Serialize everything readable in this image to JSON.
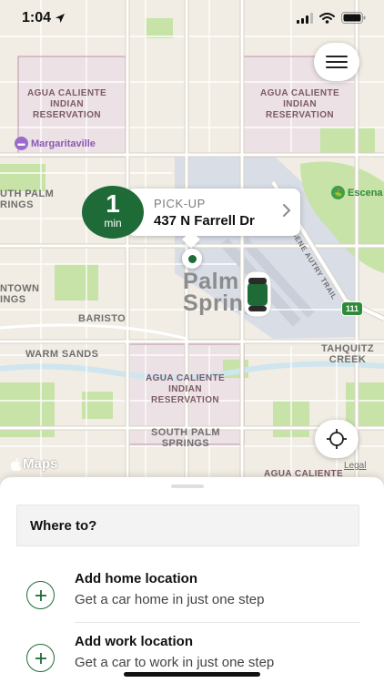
{
  "status_bar": {
    "time": "1:04"
  },
  "map": {
    "labels": {
      "res_nw": "AGUA CALIENTE\nINDIAN\nRESERVATION",
      "res_ne": "AGUA CALIENTE\nINDIAN\nRESERVATION",
      "res_center": "AGUA CALIENTE\nINDIAN\nRESERVATION",
      "res_bottom": "AGUA CALIENTE",
      "south_palm_left": "UTH PALM\nRINGS",
      "downtown": "NTOWN\nINGS",
      "baristo": "BARISTO",
      "warm_sands": "WARM SANDS",
      "tahquitz": "TAHQUITZ\nCREEK",
      "south_palm_bottom": "SOUTH PALM\nSPRINGS",
      "city": "Palm\nSprings",
      "road": "GENE AUTRY TRAIL",
      "highway": "111"
    },
    "poi": {
      "margaritaville": "Margaritaville",
      "escena": "Escena"
    },
    "brand": "Maps",
    "legal": "Legal"
  },
  "pickup": {
    "eta_value": "1",
    "eta_unit": "min",
    "label": "PICK-UP",
    "address": "437 N Farrell Dr"
  },
  "sheet": {
    "search_label": "Where to?",
    "items": [
      {
        "title": "Add home location",
        "subtitle": "Get a car home in just one step"
      },
      {
        "title": "Add work location",
        "subtitle": "Get a car to work in just one step"
      }
    ]
  },
  "colors": {
    "accent": "#1f6b37",
    "map_background": "#f1ede4",
    "park": "#c8e3a8",
    "airport": "#d8dde6"
  }
}
